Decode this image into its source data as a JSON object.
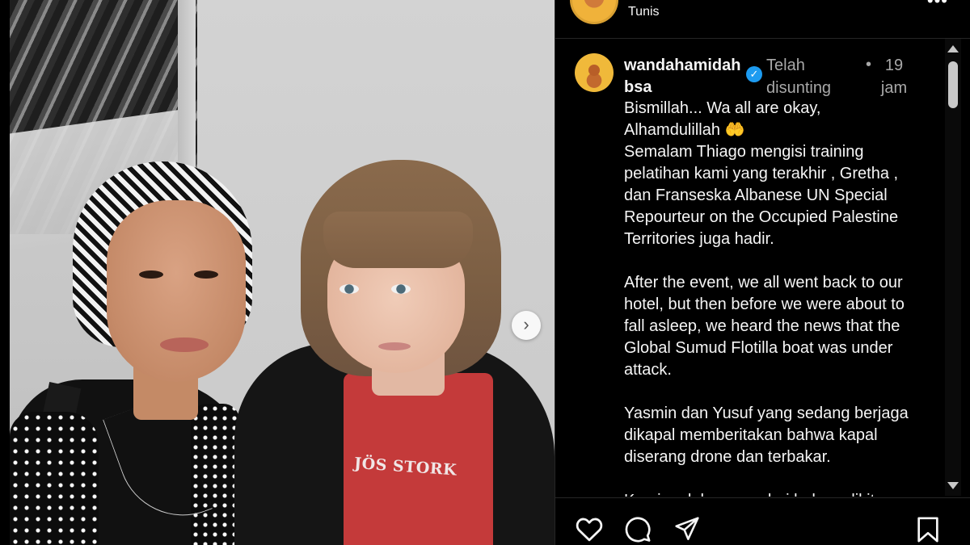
{
  "header": {
    "location": "Tunis",
    "more_icon": "more-horizontal-icon"
  },
  "post": {
    "username": "wandahamidahbsa",
    "username_line1": "wandahamidah",
    "username_line2": "bsa",
    "verified_icon": "verified-badge-icon",
    "edited_line1": "Telah",
    "edited_line2": "disunting",
    "separator": "•",
    "time_line1": "19",
    "time_line2": "jam",
    "caption": [
      "Bismillah... Wa all are okay,",
      "Alhamdulillah 🤲",
      "Semalam Thiago mengisi training",
      "pelatihan kami yang terakhir , Gretha ,",
      "dan Franseska Albanese UN Special",
      "Repourteur on the Occupied Palestine",
      "Territories juga hadir.",
      "",
      "After the event, we all went back to our",
      "hotel, but then before we were about to",
      "fall asleep, we heard the news that the",
      "Global Sumud Flotilla boat was under",
      "attack.",
      "",
      "Yasmin dan Yusuf yang sedang berjaga",
      "dikapal memberitakan bahwa kapal",
      "diserang drone dan terbakar.",
      "",
      "Kami sudah menyadari bahwa dikita"
    ]
  },
  "photo": {
    "shirt_text": "JÖS STORK",
    "next_icon": "chevron-right-icon"
  },
  "actions": {
    "icons": [
      "heart-icon",
      "comment-icon",
      "share-icon",
      "bookmark-icon"
    ]
  },
  "colors": {
    "background": "#000000",
    "text": "#f5f5f5",
    "muted": "#a8a8a8",
    "verified": "#1d9bf0",
    "divider": "#262626"
  }
}
